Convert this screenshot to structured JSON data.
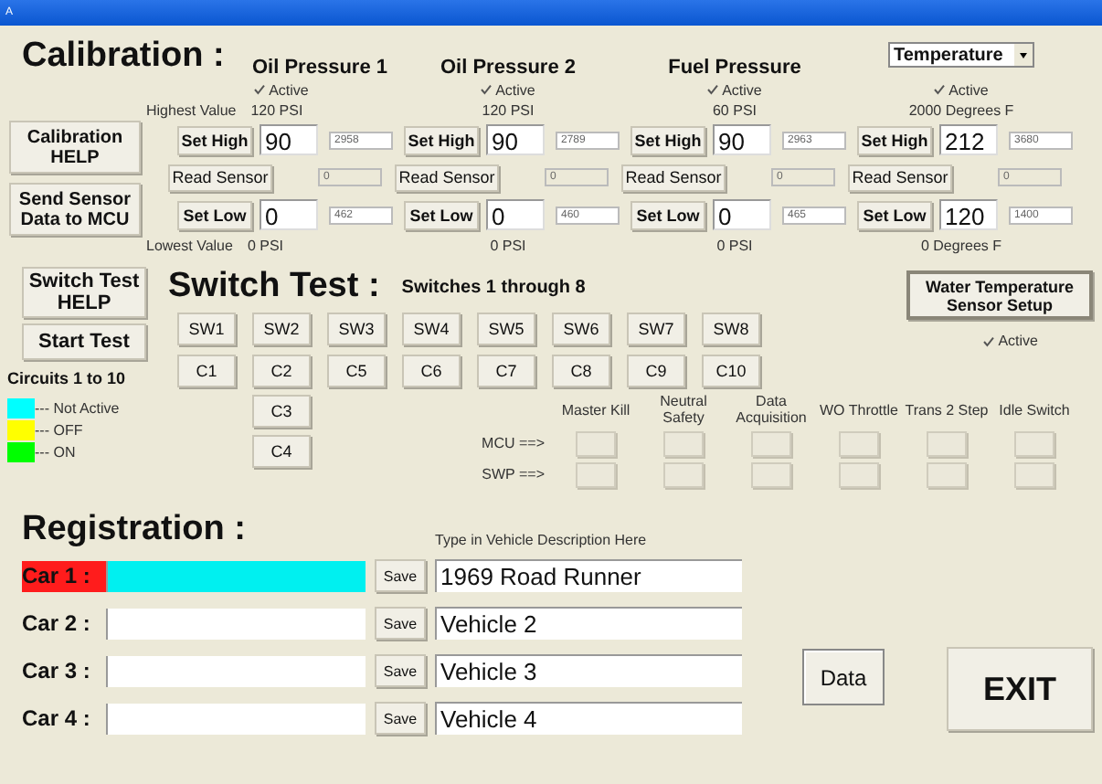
{
  "window": {
    "title": "A"
  },
  "calibration": {
    "title": "Calibration :",
    "help_button": "Calibration HELP",
    "send_button": "Send Sensor Data to MCU",
    "highest_label": "Highest Value",
    "lowest_label": "Lowest Value",
    "sensors": [
      {
        "kind": "label",
        "name": "Oil Pressure 1",
        "active_label": "Active",
        "active": true,
        "highest": "120 PSI",
        "set_high": "Set High",
        "high_value": "90",
        "high_reading": "2958",
        "read_sensor": "Read Sensor",
        "sensor_reading": "0",
        "set_low": "Set Low",
        "low_value": "0",
        "low_reading": "462",
        "lowest": "0 PSI"
      },
      {
        "kind": "label",
        "name": "Oil Pressure 2",
        "active_label": "Active",
        "active": true,
        "highest": "120 PSI",
        "set_high": "Set High",
        "high_value": "90",
        "high_reading": "2789",
        "read_sensor": "Read Sensor",
        "sensor_reading": "0",
        "set_low": "Set Low",
        "low_value": "0",
        "low_reading": "460",
        "lowest": "0 PSI"
      },
      {
        "kind": "label",
        "name": "Fuel Pressure",
        "active_label": "Active",
        "active": true,
        "highest": "60 PSI",
        "set_high": "Set High",
        "high_value": "90",
        "high_reading": "2963",
        "read_sensor": "Read Sensor",
        "sensor_reading": "0",
        "set_low": "Set Low",
        "low_value": "0",
        "low_reading": "465",
        "lowest": "0 PSI"
      },
      {
        "kind": "dropdown",
        "name": "Temperature",
        "active_label": "Active",
        "active": true,
        "highest": "2000 Degrees F",
        "set_high": "Set High",
        "high_value": "212",
        "high_reading": "3680",
        "read_sensor": "Read Sensor",
        "sensor_reading": "0",
        "set_low": "Set Low",
        "low_value": "120",
        "low_reading": "1400",
        "lowest": "0 Degrees F"
      }
    ]
  },
  "switch_test": {
    "title": "Switch Test :",
    "subtitle": "Switches  1 through 8",
    "help_button": "Switch Test HELP",
    "start_button": "Start Test",
    "circuits_label": "Circuits 1 to 10",
    "legend": [
      {
        "label": "--- Not Active",
        "color": "#00ffff"
      },
      {
        "label": "--- OFF",
        "color": "#ffff00"
      },
      {
        "label": "--- ON",
        "color": "#00ff00"
      }
    ],
    "switches": [
      "SW1",
      "SW2",
      "SW3",
      "SW4",
      "SW5",
      "SW6",
      "SW7",
      "SW8"
    ],
    "circuit_columns": [
      [
        "C1"
      ],
      [
        "C2",
        "C3",
        "C4"
      ],
      [
        "C5"
      ],
      [
        "C6"
      ],
      [
        "C7"
      ],
      [
        "C8"
      ],
      [
        "C9"
      ],
      [
        "C10"
      ]
    ],
    "water_button": "Water Temperature Sensor Setup",
    "water_active": {
      "label": "Active",
      "checked": true
    },
    "outputs": {
      "columns": [
        "Master Kill",
        "Neutral Safety",
        "Data Acquisition",
        "WO Throttle",
        "Trans 2 Step",
        "Idle Switch"
      ],
      "rows": [
        "MCU ==>",
        "SWP ==>"
      ]
    }
  },
  "registration": {
    "title": "Registration :",
    "hint": "Type in Vehicle Description Here",
    "cars": [
      {
        "label": "Car 1 :",
        "selected": true,
        "save": "Save",
        "description": "1969 Road Runner"
      },
      {
        "label": "Car 2 :",
        "selected": false,
        "save": "Save",
        "description": "Vehicle 2"
      },
      {
        "label": "Car 3 :",
        "selected": false,
        "save": "Save",
        "description": "Vehicle 3"
      },
      {
        "label": "Car 4 :",
        "selected": false,
        "save": "Save",
        "description": "Vehicle 4"
      }
    ],
    "data_button": "Data",
    "exit_button": "EXIT"
  }
}
